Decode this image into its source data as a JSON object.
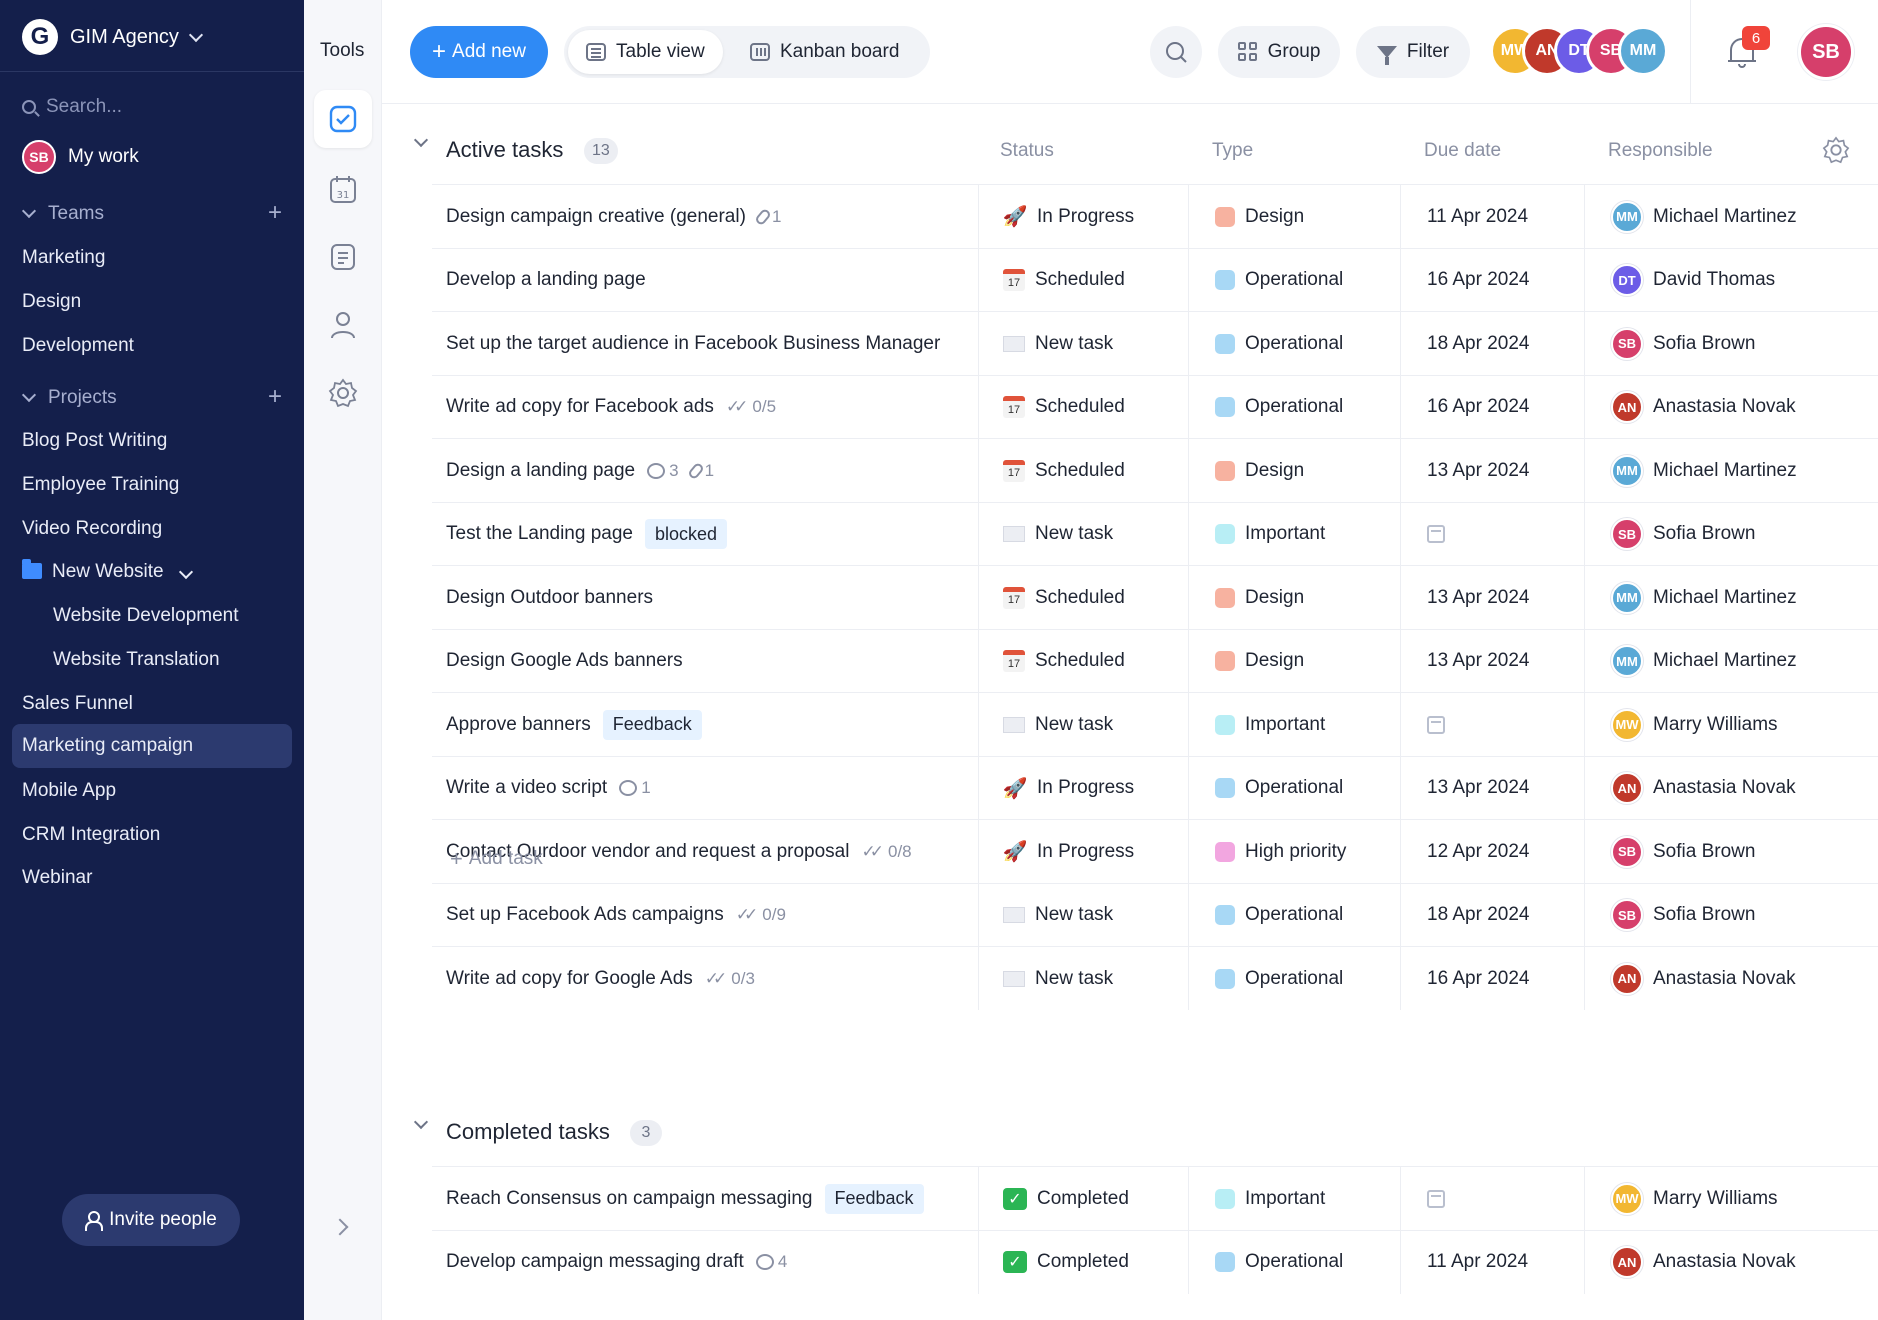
{
  "workspace": {
    "name": "GIM Agency",
    "logo_letter": "G"
  },
  "sidebar": {
    "search_placeholder": "Search...",
    "my_work": "My work",
    "teams_label": "Teams",
    "teams": [
      "Marketing",
      "Design",
      "Development"
    ],
    "projects_label": "Projects",
    "projects": [
      "Blog Post Writing",
      "Employee Training",
      "Video Recording"
    ],
    "folder": {
      "label": "New Website",
      "children": [
        "Website Development",
        "Website Translation"
      ]
    },
    "projects_after": [
      "Sales Funnel",
      "Marketing campaign",
      "Mobile App",
      "CRM Integration",
      "Webinar"
    ],
    "active_project": "Marketing campaign",
    "invite_label": "Invite people"
  },
  "tools": {
    "title": "Tools",
    "items": [
      "tasks-icon",
      "calendar-icon",
      "notes-icon",
      "person-icon",
      "settings-icon"
    ],
    "calendar_day": "31"
  },
  "topbar": {
    "add_new": "Add new",
    "views": [
      "Table view",
      "Kanban board"
    ],
    "active_view": "Table view",
    "group": "Group",
    "filter": "Filter",
    "team_avatar_colors": [
      "#f2b731",
      "#e0533a",
      "#6c5ce7",
      "#e84393",
      "#7ec8e3"
    ],
    "notifications": "6"
  },
  "columns": {
    "status": "Status",
    "type": "Type",
    "due": "Due date",
    "responsible": "Responsible"
  },
  "active": {
    "title": "Active tasks",
    "count": "13",
    "tasks": [
      {
        "name": "Design campaign creative (general)",
        "attachments": "1",
        "status": "In Progress",
        "status_icon": "rocket",
        "type": "Design",
        "due": "11 Apr 2024",
        "responsible": "Michael Martinez"
      },
      {
        "name": "Develop a landing page",
        "status": "Scheduled",
        "status_icon": "calendar",
        "type": "Operational",
        "due": "16 Apr 2024",
        "responsible": "David Thomas"
      },
      {
        "name": "Set up the target audience in Facebook Business Manager",
        "status": "New task",
        "status_icon": "mail",
        "type": "Operational",
        "due": "18 Apr 2024",
        "responsible": "Sofia Brown"
      },
      {
        "name": "Write ad copy for Facebook ads",
        "checklist": "0/5",
        "status": "Scheduled",
        "status_icon": "calendar",
        "type": "Operational",
        "due": "16 Apr 2024",
        "responsible": "Anastasia Novak"
      },
      {
        "name": "Design a landing page",
        "comments": "3",
        "attachments": "1",
        "status": "Scheduled",
        "status_icon": "calendar",
        "type": "Design",
        "due": "13 Apr 2024",
        "responsible": "Michael Martinez"
      },
      {
        "name": "Test the Landing page",
        "tag": "blocked",
        "status": "New task",
        "status_icon": "mail",
        "type": "Important",
        "due": "",
        "responsible": "Sofia Brown"
      },
      {
        "name": "Design Outdoor banners",
        "status": "Scheduled",
        "status_icon": "calendar",
        "type": "Design",
        "due": "13 Apr 2024",
        "responsible": "Michael Martinez"
      },
      {
        "name": "Design Google Ads banners",
        "status": "Scheduled",
        "status_icon": "calendar",
        "type": "Design",
        "due": "13 Apr 2024",
        "responsible": "Michael Martinez"
      },
      {
        "name": "Approve banners",
        "tag": "Feedback",
        "status": "New task",
        "status_icon": "mail",
        "type": "Important",
        "due": "",
        "responsible": "Marry Williams"
      },
      {
        "name": "Write a video script",
        "comments": "1",
        "status": "In Progress",
        "status_icon": "rocket",
        "type": "Operational",
        "due": "13 Apr 2024",
        "responsible": "Anastasia Novak"
      },
      {
        "name": "Contact Ourdoor vendor and request a proposal",
        "checklist": "0/8",
        "status": "In Progress",
        "status_icon": "rocket",
        "type": "High priority",
        "due": "12 Apr 2024",
        "responsible": "Sofia Brown"
      },
      {
        "name": "Set up Facebook Ads campaigns",
        "checklist": "0/9",
        "status": "New task",
        "status_icon": "mail",
        "type": "Operational",
        "due": "18 Apr 2024",
        "responsible": "Sofia Brown"
      },
      {
        "name": "Write ad copy for Google Ads",
        "checklist": "0/3",
        "status": "New task",
        "status_icon": "mail",
        "type": "Operational",
        "due": "16 Apr 2024",
        "responsible": "Anastasia Novak"
      }
    ],
    "add_task": "Add task"
  },
  "completed": {
    "title": "Completed tasks",
    "count": "3",
    "tasks": [
      {
        "name": "Reach Consensus on campaign messaging",
        "tag": "Feedback",
        "status": "Completed",
        "status_icon": "done",
        "type": "Important",
        "due": "",
        "responsible": "Marry Williams"
      },
      {
        "name": "Develop campaign messaging draft",
        "comments": "4",
        "status": "Completed",
        "status_icon": "done",
        "type": "Operational",
        "due": "11 Apr 2024",
        "responsible": "Anastasia Novak"
      }
    ]
  },
  "type_colors": {
    "Design": "#f7b2a0",
    "Operational": "#a8d8f5",
    "Important": "#b8eef5",
    "High priority": "#f2a6e0"
  },
  "people_colors": {
    "Michael Martinez": "#5aa9d6",
    "David Thomas": "#6c5ce7",
    "Sofia Brown": "#d63f6b",
    "Anastasia Novak": "#c0392b",
    "Marry Williams": "#f2b731"
  },
  "brand": {
    "accent": "#2f8af5",
    "sidebar": "#141f4b",
    "badge": "#f0443a"
  }
}
